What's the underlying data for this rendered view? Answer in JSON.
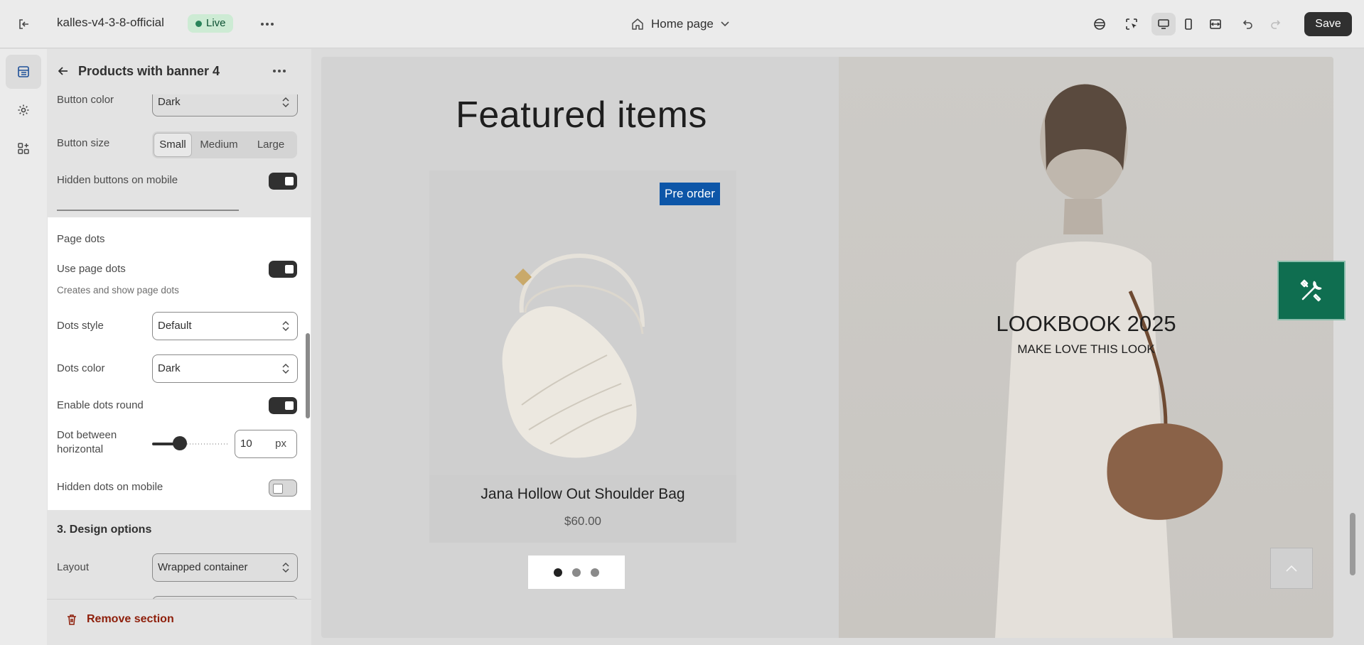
{
  "topbar": {
    "store_name": "kalles-v4-3-8-official",
    "live_label": "Live",
    "page_selector": "Home page",
    "save_label": "Save"
  },
  "panel": {
    "title": "Products with banner 4",
    "button_color": {
      "label": "Button color",
      "value": "Dark"
    },
    "button_size": {
      "label": "Button size",
      "options": [
        "Small",
        "Medium",
        "Large"
      ],
      "selected": "Small"
    },
    "hidden_buttons_mobile": {
      "label": "Hidden buttons on mobile",
      "enabled": true
    },
    "page_dots": {
      "heading": "Page dots",
      "use_page_dots": {
        "label": "Use page dots",
        "help": "Creates and show page dots",
        "enabled": true
      },
      "dots_style": {
        "label": "Dots style",
        "value": "Default"
      },
      "dots_color": {
        "label": "Dots color",
        "value": "Dark"
      },
      "enable_dots_round": {
        "label": "Enable dots round",
        "enabled": true
      },
      "dot_between_horizontal": {
        "label_line1": "Dot between",
        "label_line2": "horizontal",
        "value": "10",
        "unit": "px",
        "slider_fraction": 0.36
      },
      "hidden_dots_mobile": {
        "label": "Hidden dots on mobile",
        "enabled": false
      }
    },
    "design_options": {
      "heading": "3. Design options",
      "layout": {
        "label": "Layout",
        "value": "Wrapped container"
      }
    },
    "remove_section_label": "Remove section"
  },
  "preview": {
    "featured_title": "Featured items",
    "product": {
      "badge": "Pre order",
      "name": "Jana Hollow Out Shoulder Bag",
      "price": "$60.00"
    },
    "dots": {
      "count": 3,
      "active_index": 0
    },
    "banner": {
      "title": "LOOKBOOK 2025",
      "subtitle": "MAKE LOVE THIS LOOK"
    }
  },
  "colors": {
    "live_green": "#29845a",
    "badge_blue": "#0d56a8",
    "tools_green": "#0f6e50",
    "remove_red": "#8e1f0b"
  }
}
